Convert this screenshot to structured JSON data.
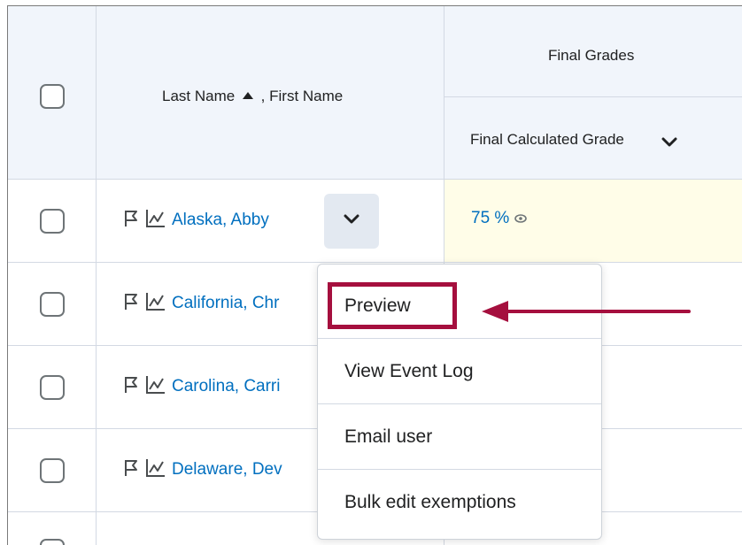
{
  "header": {
    "name_column": "Last Name",
    "sort_icon": "caret-up-icon",
    "name_suffix": ", First Name",
    "group_title": "Final Grades",
    "grade_column": "Final Calculated Grade"
  },
  "rows": [
    {
      "name": "Alaska, Abby",
      "grade": "75 %"
    },
    {
      "name": "California, Chr"
    },
    {
      "name": "Carolina, Carri"
    },
    {
      "name": "Delaware, Dev"
    }
  ],
  "context_menu": {
    "items": [
      "Preview",
      "View Event Log",
      "Email user",
      "Bulk edit exemptions"
    ]
  },
  "annotation": {
    "color": "#a50f3e",
    "target": "Preview"
  },
  "colors": {
    "link": "#006fbf",
    "header_bg": "#f1f5fb",
    "highlight_bg": "#fffde8"
  }
}
